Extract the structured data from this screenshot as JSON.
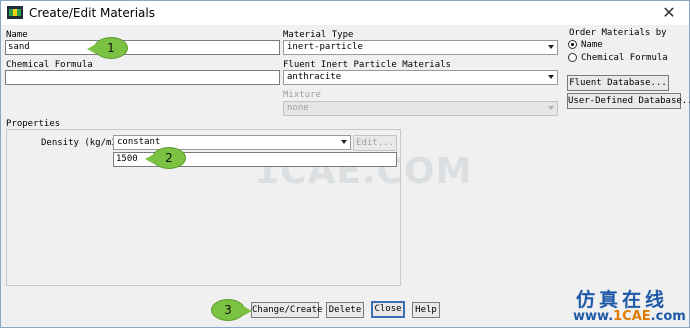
{
  "window": {
    "title": "Create/Edit Materials"
  },
  "name": {
    "label": "Name",
    "value": "sand"
  },
  "chemical_formula": {
    "label": "Chemical Formula",
    "value": ""
  },
  "material_type": {
    "label": "Material Type",
    "value": "inert-particle"
  },
  "fluent_materials": {
    "label": "Fluent Inert Particle Materials",
    "value": "anthracite"
  },
  "mixture": {
    "label": "Mixture",
    "value": "none"
  },
  "order": {
    "label": "Order Materials by",
    "options": [
      {
        "label": "Name",
        "selected": true
      },
      {
        "label": "Chemical Formula",
        "selected": false
      }
    ]
  },
  "side_buttons": {
    "fluent_db": "Fluent Database...",
    "user_db": "User-Defined Database..."
  },
  "properties": {
    "label": "Properties",
    "density_label": "Density (kg/m3)",
    "density_method": "constant",
    "edit_button": "Edit...",
    "density_value": "1500"
  },
  "bottom_buttons": {
    "change_create": "Change/Create",
    "delete": "Delete",
    "close": "Close",
    "help": "Help"
  },
  "callouts": {
    "one": "1",
    "two": "2",
    "three": "3"
  },
  "watermark": "1CAE.COM",
  "brand": {
    "cn": "仿真在线",
    "url_prefix": "www.",
    "url_main": "1CAE",
    "url_suffix": ".com"
  }
}
